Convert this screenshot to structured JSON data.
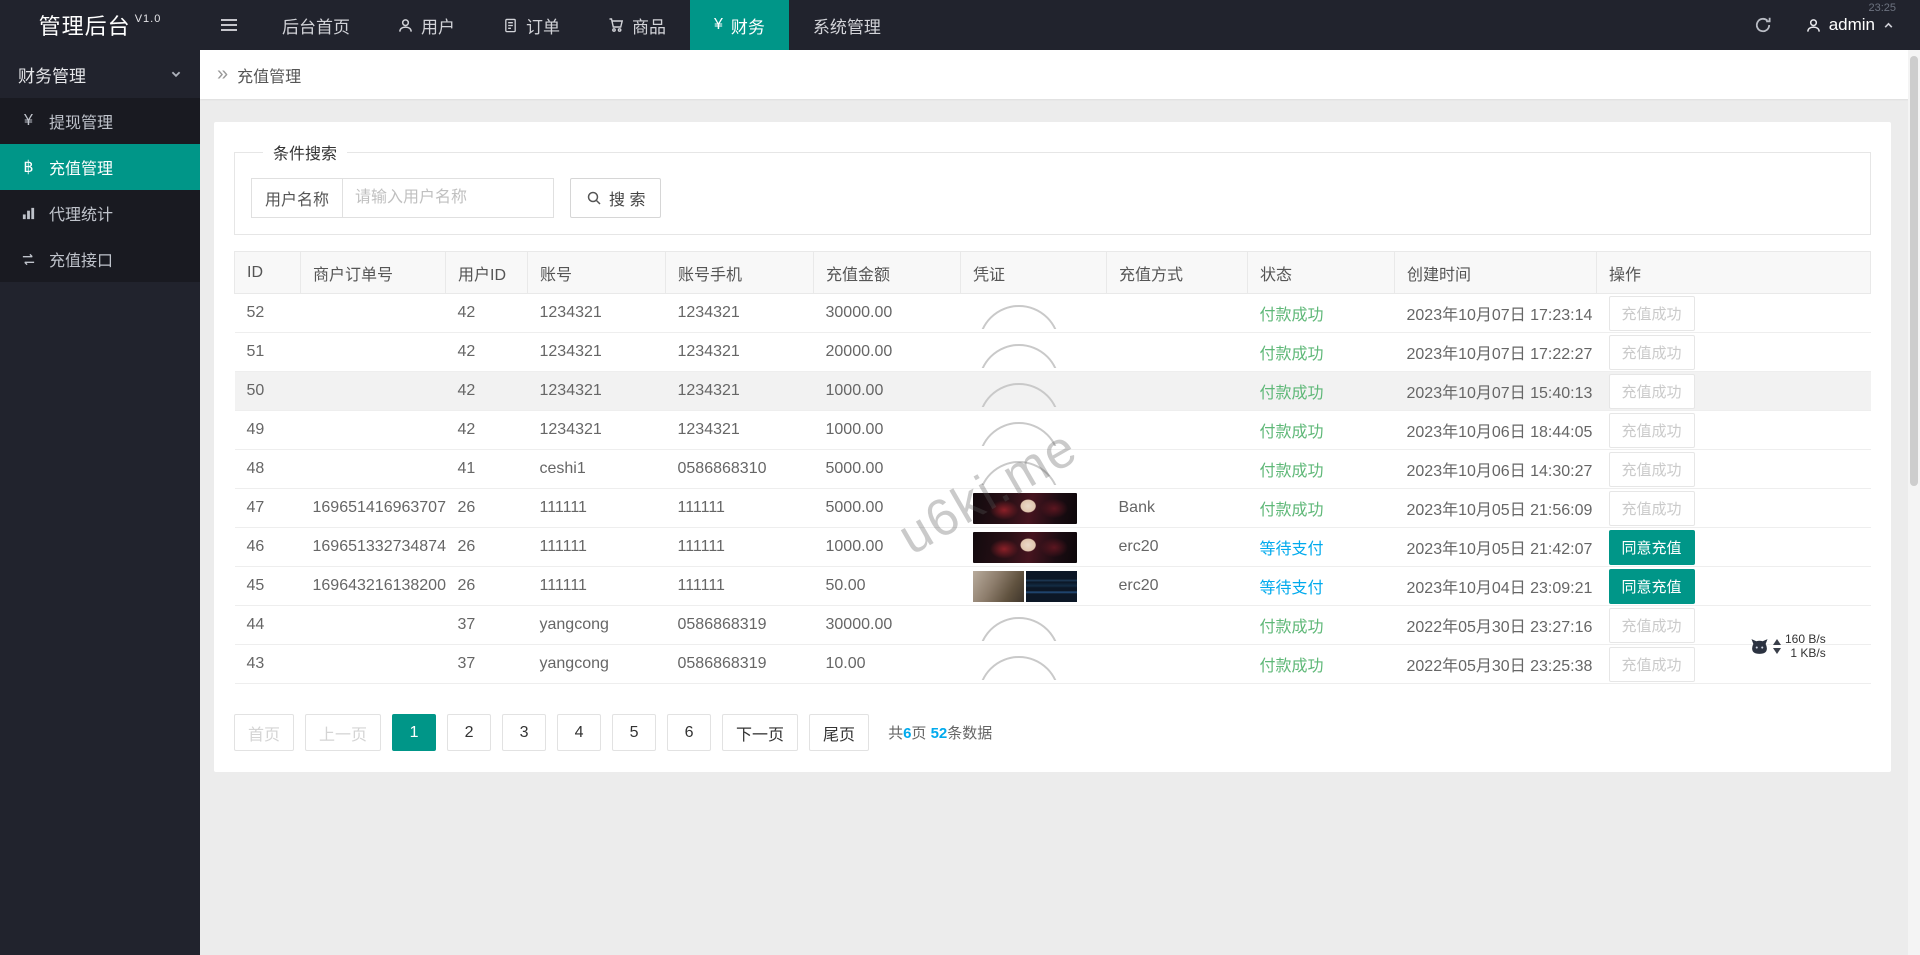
{
  "app": {
    "title": "管理后台",
    "version": "V1.0"
  },
  "clock": "23:25",
  "navbar": {
    "items": [
      {
        "label": "后台首页",
        "icon": "none",
        "active": false
      },
      {
        "label": "用户",
        "icon": "user-icon",
        "active": false
      },
      {
        "label": "订单",
        "icon": "document-icon",
        "active": false
      },
      {
        "label": "商品",
        "icon": "cart-icon",
        "active": false
      },
      {
        "label": "财务",
        "icon": "yen-icon",
        "glyph": "¥",
        "active": true
      },
      {
        "label": "系统管理",
        "icon": "none",
        "active": false
      }
    ],
    "admin_label": "admin"
  },
  "sidebar": {
    "group_label": "财务管理",
    "items": [
      {
        "label": "提现管理",
        "icon": "withdraw-icon",
        "glyph": "¥",
        "active": false
      },
      {
        "label": "充值管理",
        "icon": "bitcoin-icon",
        "glyph": "฿",
        "active": true
      },
      {
        "label": "代理统计",
        "icon": "chart-icon",
        "active": false
      },
      {
        "label": "充值接口",
        "icon": "transfer-icon",
        "active": false
      }
    ]
  },
  "breadcrumb": {
    "separator": "»",
    "current": "充值管理"
  },
  "search": {
    "legend": "条件搜索",
    "field_label": "用户名称",
    "placeholder": "请输入用户名称",
    "input_value": "",
    "button_label": "搜 索"
  },
  "table": {
    "headers": [
      "ID",
      "商户订单号",
      "用户ID",
      "账号",
      "账号手机",
      "充值金额",
      "凭证",
      "充值方式",
      "状态",
      "创建时间",
      "操作"
    ],
    "rows": [
      {
        "id": "52",
        "order_no": "",
        "user_id": "42",
        "account": "1234321",
        "phone": "1234321",
        "amount": "30000.00",
        "voucher": "placeholder-arc",
        "method": "",
        "status": "付款成功",
        "status_type": "success",
        "created_at": "2023年10月07日 17:23:14",
        "action": "充值成功",
        "action_type": "done",
        "shaded": false
      },
      {
        "id": "51",
        "order_no": "",
        "user_id": "42",
        "account": "1234321",
        "phone": "1234321",
        "amount": "20000.00",
        "voucher": "placeholder-arc",
        "method": "",
        "status": "付款成功",
        "status_type": "success",
        "created_at": "2023年10月07日 17:22:27",
        "action": "充值成功",
        "action_type": "done",
        "shaded": false
      },
      {
        "id": "50",
        "order_no": "",
        "user_id": "42",
        "account": "1234321",
        "phone": "1234321",
        "amount": "1000.00",
        "voucher": "placeholder-arc",
        "method": "",
        "status": "付款成功",
        "status_type": "success",
        "created_at": "2023年10月07日 15:40:13",
        "action": "充值成功",
        "action_type": "done",
        "shaded": true
      },
      {
        "id": "49",
        "order_no": "",
        "user_id": "42",
        "account": "1234321",
        "phone": "1234321",
        "amount": "1000.00",
        "voucher": "placeholder-arc",
        "method": "",
        "status": "付款成功",
        "status_type": "success",
        "created_at": "2023年10月06日 18:44:05",
        "action": "充值成功",
        "action_type": "done",
        "shaded": false
      },
      {
        "id": "48",
        "order_no": "",
        "user_id": "41",
        "account": "ceshi1",
        "phone": "0586868310",
        "amount": "5000.00",
        "voucher": "placeholder-arc",
        "method": "",
        "status": "付款成功",
        "status_type": "success",
        "created_at": "2023年10月06日 14:30:27",
        "action": "充值成功",
        "action_type": "done",
        "shaded": false
      },
      {
        "id": "47",
        "order_no": "169651416963707",
        "user_id": "26",
        "account": "111111",
        "phone": "111111",
        "amount": "5000.00",
        "voucher": "photo-face",
        "method": "Bank",
        "status": "付款成功",
        "status_type": "success",
        "created_at": "2023年10月05日 21:56:09",
        "action": "充值成功",
        "action_type": "done",
        "shaded": false
      },
      {
        "id": "46",
        "order_no": "169651332734874",
        "user_id": "26",
        "account": "111111",
        "phone": "111111",
        "amount": "1000.00",
        "voucher": "photo-face",
        "method": "erc20",
        "status": "等待支付",
        "status_type": "waiting",
        "created_at": "2023年10月05日 21:42:07",
        "action": "同意充值",
        "action_type": "approve",
        "shaded": false
      },
      {
        "id": "45",
        "order_no": "169643216138200",
        "user_id": "26",
        "account": "111111",
        "phone": "111111",
        "amount": "50.00",
        "voucher": "photo-pair",
        "method": "erc20",
        "status": "等待支付",
        "status_type": "waiting",
        "created_at": "2023年10月04日 23:09:21",
        "action": "同意充值",
        "action_type": "approve",
        "shaded": false
      },
      {
        "id": "44",
        "order_no": "",
        "user_id": "37",
        "account": "yangcong",
        "phone": "0586868319",
        "amount": "30000.00",
        "voucher": "placeholder-arc",
        "method": "",
        "status": "付款成功",
        "status_type": "success",
        "created_at": "2022年05月30日 23:27:16",
        "action": "充值成功",
        "action_type": "done",
        "shaded": false
      },
      {
        "id": "43",
        "order_no": "",
        "user_id": "37",
        "account": "yangcong",
        "phone": "0586868319",
        "amount": "10.00",
        "voucher": "placeholder-arc",
        "method": "",
        "status": "付款成功",
        "status_type": "success",
        "created_at": "2022年05月30日 23:25:38",
        "action": "充值成功",
        "action_type": "done",
        "shaded": false
      }
    ]
  },
  "pagination": {
    "first": "首页",
    "prev": "上一页",
    "next": "下一页",
    "last": "尾页",
    "pages": [
      "1",
      "2",
      "3",
      "4",
      "5",
      "6"
    ],
    "active_page": "1",
    "info": {
      "prefix": "共",
      "pages": "6",
      "mid": "页 ",
      "records": "52",
      "suffix": "条数据"
    }
  },
  "watermark": "u6ki.me",
  "speed_monitor": {
    "upload": "160 B/s",
    "download": "1 KB/s"
  },
  "colors": {
    "accent": "#009688",
    "success": "#5FB878",
    "waiting": "#01AAED",
    "dark": "#21232d"
  }
}
